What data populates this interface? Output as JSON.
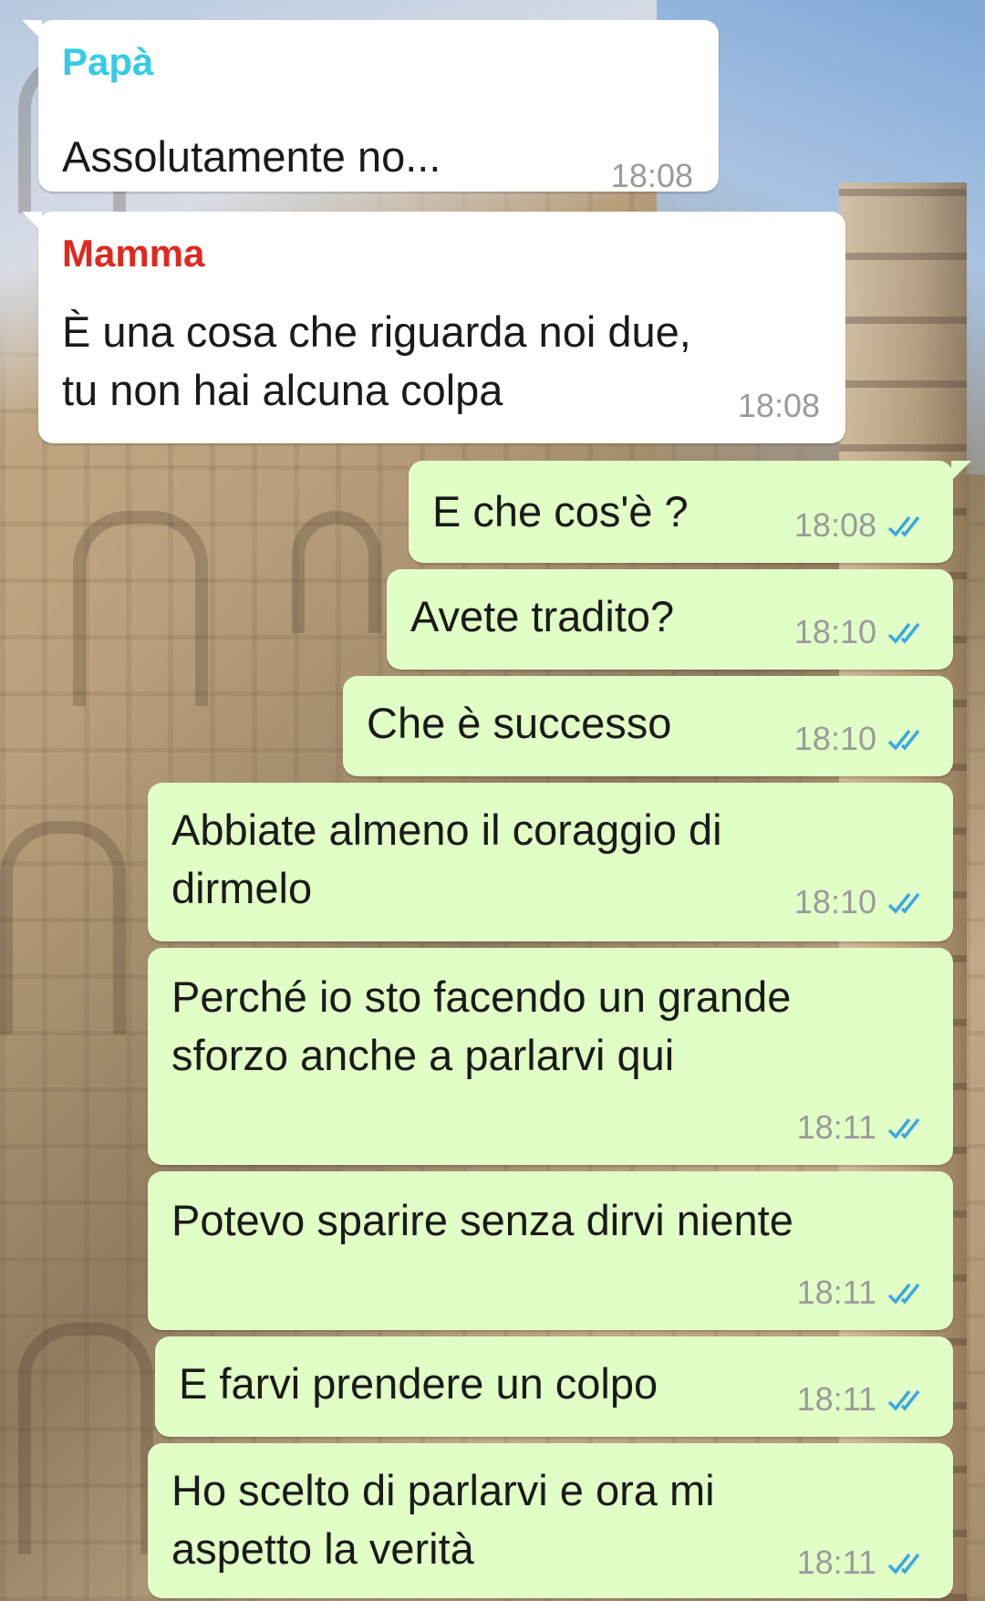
{
  "chat": {
    "colors": {
      "incoming_bg": "#ffffff",
      "outgoing_bg": "#e1fec6",
      "sender_papa": "#35cbe6",
      "sender_mamma": "#e0281f",
      "time": "#9a9a9a",
      "read_ticks": "#3ba7e0"
    },
    "messages": [
      {
        "sender": "Papà",
        "text": "Assolutamente no...",
        "time": "18:08"
      },
      {
        "sender": "Mamma",
        "lines": [
          "È una cosa che riguarda noi due,",
          "tu non hai alcuna colpa"
        ],
        "time": "18:08"
      },
      {
        "lines": [
          "E che cos'è ?"
        ],
        "time": "18:08",
        "status": "read"
      },
      {
        "lines": [
          "Avete tradito?"
        ],
        "time": "18:10",
        "status": "read"
      },
      {
        "lines": [
          "Che è successo"
        ],
        "time": "18:10",
        "status": "read"
      },
      {
        "lines": [
          "Abbiate almeno il coraggio di",
          "dirmelo"
        ],
        "time": "18:10",
        "status": "read"
      },
      {
        "lines": [
          "Perché io sto facendo un grande",
          "sforzo anche a parlarvi qui"
        ],
        "time": "18:11",
        "status": "read"
      },
      {
        "lines": [
          "Potevo sparire senza dirvi niente"
        ],
        "time": "18:11",
        "status": "read"
      },
      {
        "lines": [
          "E farvi prendere un colpo"
        ],
        "time": "18:11",
        "status": "read"
      },
      {
        "lines": [
          "Ho scelto di parlarvi e ora mi",
          "aspetto la verità"
        ],
        "time": "18:11",
        "status": "read"
      }
    ]
  }
}
